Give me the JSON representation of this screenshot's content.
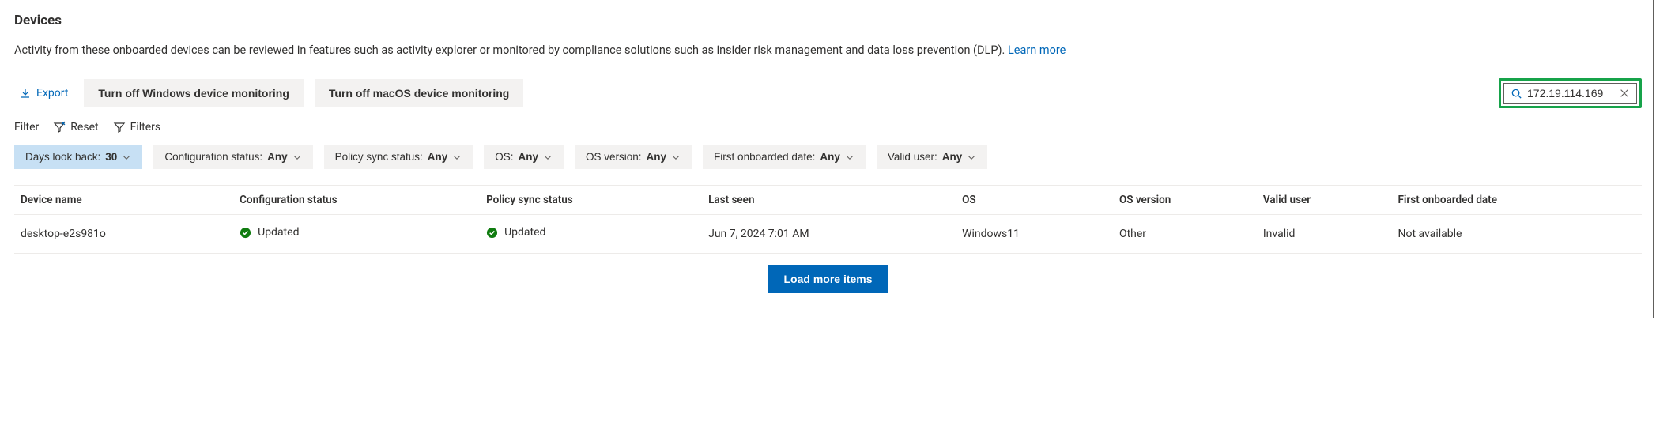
{
  "header": {
    "title": "Devices",
    "description": "Activity from these onboarded devices can be reviewed in features such as activity explorer or monitored by compliance solutions such as insider risk management and data loss prevention (DLP).",
    "learn_more": "Learn more"
  },
  "toolbar": {
    "export_label": "Export",
    "turn_off_windows_label": "Turn off Windows device monitoring",
    "turn_off_macos_label": "Turn off macOS device monitoring",
    "search_value": "172.19.114.169"
  },
  "filter_bar": {
    "label": "Filter",
    "reset_label": "Reset",
    "filters_label": "Filters"
  },
  "pills": [
    {
      "label": "Days look back:",
      "value": "30",
      "active": true
    },
    {
      "label": "Configuration status:",
      "value": "Any",
      "active": false
    },
    {
      "label": "Policy sync status:",
      "value": "Any",
      "active": false
    },
    {
      "label": "OS:",
      "value": "Any",
      "active": false
    },
    {
      "label": "OS version:",
      "value": "Any",
      "active": false
    },
    {
      "label": "First onboarded date:",
      "value": "Any",
      "active": false
    },
    {
      "label": "Valid user:",
      "value": "Any",
      "active": false
    }
  ],
  "table": {
    "columns": [
      "Device name",
      "Configuration status",
      "Policy sync status",
      "Last seen",
      "OS",
      "OS version",
      "Valid user",
      "First onboarded date"
    ],
    "rows": [
      {
        "device_name": "desktop-e2s981o",
        "configuration_status": "Updated",
        "policy_sync_status": "Updated",
        "last_seen": "Jun 7, 2024 7:01 AM",
        "os": "Windows11",
        "os_version": "Other",
        "valid_user": "Invalid",
        "first_onboarded_date": "Not available"
      }
    ]
  },
  "footer": {
    "load_more_label": "Load more items"
  }
}
